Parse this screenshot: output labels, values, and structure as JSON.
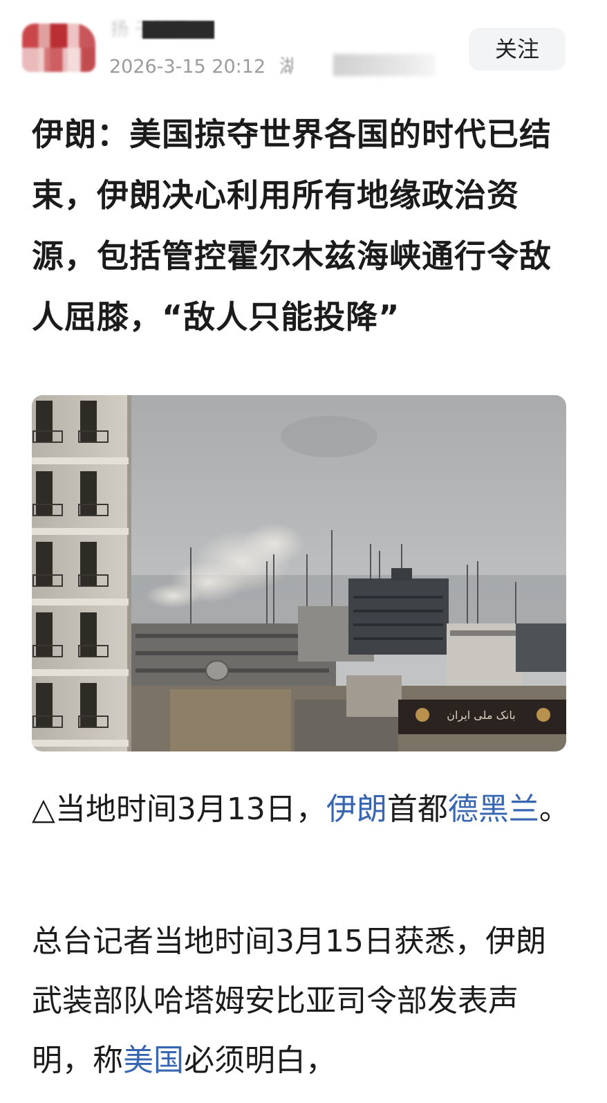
{
  "header": {
    "author_name": "扬 子新闻",
    "timestamp": "2026-3-15 20:12",
    "location_fragment": "湖",
    "follow_label": "关注"
  },
  "article": {
    "title": "伊朗：美国掠夺世界各国的时代已结束，伊朗决心利用所有地缘政治资源，包括管控霍尔木兹海峡通行令敌人屈膝，“敌人只能投降”",
    "photo_alt": "Tehran skyline with smoke rising",
    "photo_sign_text": "بانک ملی ایران",
    "caption": {
      "marker": "△",
      "prefix": "当地时间3月13日，",
      "link1": "伊朗",
      "middle": "首都",
      "link2": "德黑兰",
      "suffix": "。"
    },
    "paragraph": {
      "part1": "总台记者当地时间3月15日获悉，伊朗武装部队哈塔姆安比亚司令部发表声明，称",
      "link": "美国",
      "part2": "必须明白，"
    }
  },
  "colors": {
    "link": "#3866b0",
    "text": "#1b1b1b",
    "meta": "#9b9b9b",
    "button_bg": "#f3f4f6"
  }
}
